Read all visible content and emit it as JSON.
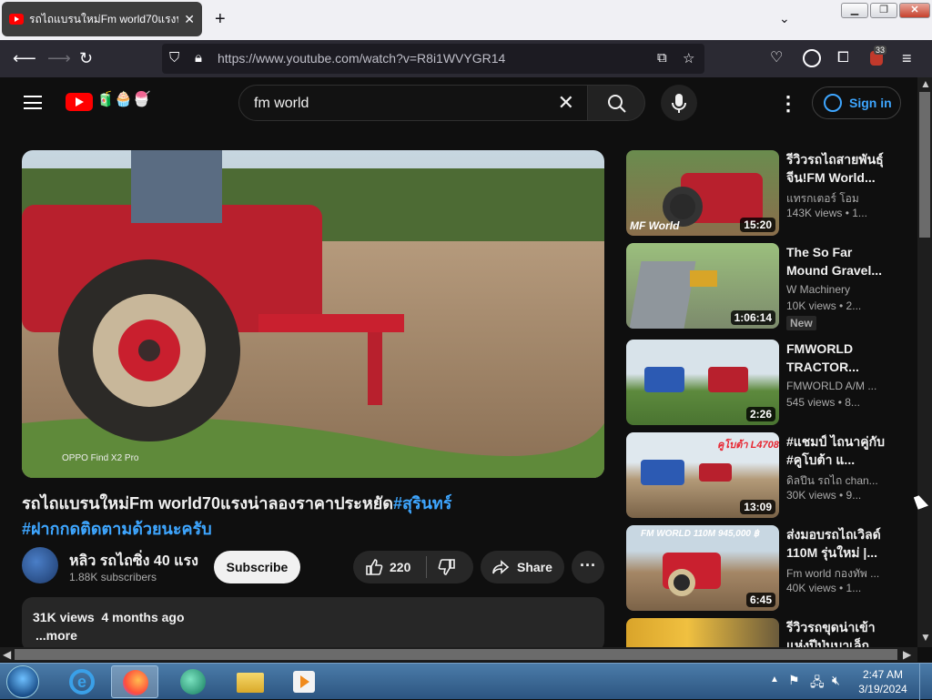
{
  "browser": {
    "tab_title": "รถไถแบรนใหม่Fm world70แรงน่า",
    "url": "https://www.youtube.com/watch?v=R8i1WVYGR14",
    "extension_badge": "33"
  },
  "youtube": {
    "search_query": "fm world",
    "sign_in": "Sign in"
  },
  "video": {
    "title_main": "รถไถแบรนใหม่Fm world70แรงน่าลองราคาประหยัด",
    "tag1": "#สุรินทร์",
    "tag2": "#ฝากกดติดตามด้วยนะครับ",
    "watermark": "OPPO Find X2 Pro",
    "channel_name": "หลิว รถไถซิ่ง 40 แรง",
    "subscribers": "1.88K subscribers",
    "subscribe_label": "Subscribe",
    "likes": "220",
    "share_label": "Share",
    "views": "31K views",
    "age": "4 months ago",
    "more": "...more"
  },
  "recommendations": [
    {
      "title": "รีวิวรถไถสายพันธุ์จีน!FM World...",
      "channel": "แทรกเตอร์ โอม",
      "meta": "143K views • 1...",
      "duration": "15:20",
      "thumb_text": "MF World"
    },
    {
      "title": "The So Far Mound Gravel...",
      "channel": "W Machinery",
      "meta": "10K views • 2...",
      "duration": "1:06:14",
      "badge": "New"
    },
    {
      "title": "FMWORLD TRACTOR...",
      "channel": "FMWORLD A/M ...",
      "meta": "545 views • 8...",
      "duration": "2:26"
    },
    {
      "title": "#แชมป์ ไถนาคู่กับ #คูโบต้า แ...",
      "channel": "ดิลปีน รถไถ chan...",
      "meta": "30K views • 9...",
      "duration": "13:09",
      "thumb_text": "คูโบต้า L4708"
    },
    {
      "title": "ส่งมอบรถไถเวิลด์ 110M รุ่นใหม่ |...",
      "channel": "Fm world กองทัพ ...",
      "meta": "40K views • 1...",
      "duration": "6:45",
      "thumb_text": "FM WORLD 110M 945,000 ฿"
    },
    {
      "title": "รีวิวรถขุดน่าเข้าแห่งปีปุ่นบาเล็ก",
      "channel": "",
      "meta": "",
      "duration": ""
    }
  ],
  "taskbar": {
    "time": "2:47 AM",
    "date": "3/19/2024"
  }
}
